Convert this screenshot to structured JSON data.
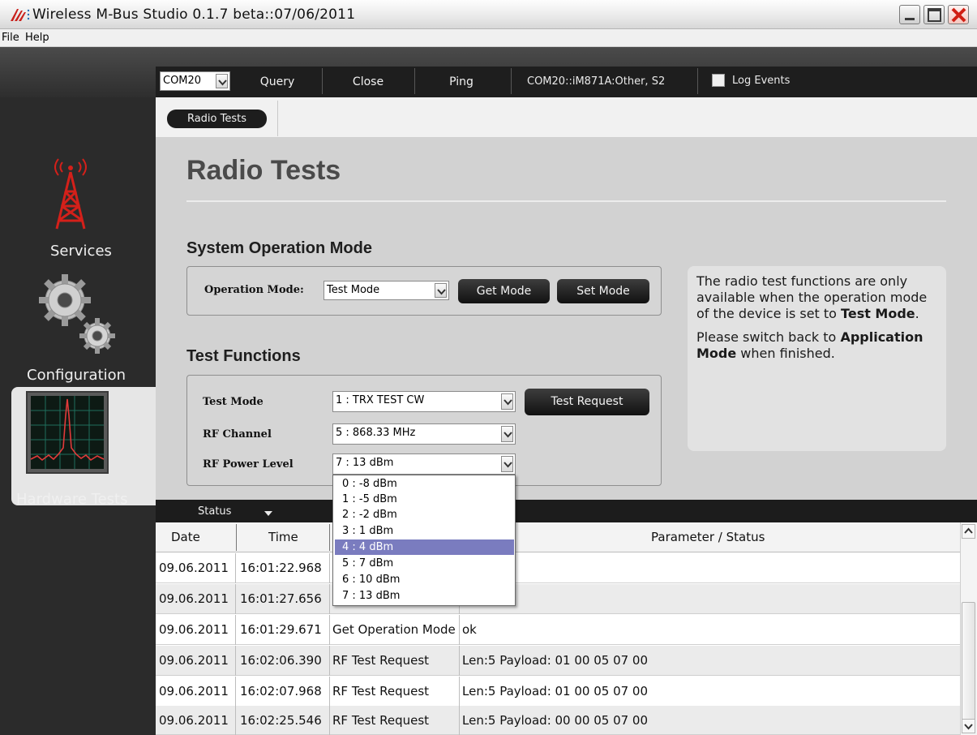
{
  "window": {
    "title": "Wireless M-Bus Studio  0.1.7 beta::07/06/2011"
  },
  "menu": {
    "items": [
      "File",
      "Help"
    ]
  },
  "toolbar": {
    "port_value": "COM20",
    "buttons": [
      "Query",
      "Close",
      "Ping"
    ],
    "connection_status": "COM20::iM871A:Other, S2",
    "log_events_label": "Log Events"
  },
  "sidebar": {
    "items": [
      {
        "label": "Services",
        "icon": "radio-tower-icon"
      },
      {
        "label": "Configuration",
        "icon": "gears-icon"
      },
      {
        "label": "Hardware Tests",
        "icon": "oscilloscope-icon"
      }
    ],
    "selected": "Hardware Tests"
  },
  "breadcrumb": {
    "current": "Radio Tests"
  },
  "page": {
    "title": "Radio Tests",
    "system_section": "System Operation Mode",
    "operation_mode_label": "Operation Mode:",
    "operation_mode_value": "Test Mode",
    "get_mode_label": "Get Mode",
    "set_mode_label": "Set Mode",
    "test_section": "Test Functions",
    "test_mode_label": "Test Mode",
    "test_mode_value": "1 : TRX TEST CW",
    "test_request_label": "Test Request",
    "rf_channel_label": "RF Channel",
    "rf_channel_value": "5 : 868.33 MHz",
    "rf_power_label": "RF Power Level",
    "rf_power_value": "7 : 13 dBm"
  },
  "info": {
    "p1_a": "The radio test functions are only available when the operation mode of the device is set to ",
    "p1_b": "Test Mode",
    "p1_c": ".",
    "p2_a": "Please switch back to ",
    "p2_b": "Application Mode",
    "p2_c": " when finished."
  },
  "dropdown": {
    "options": [
      "0 : -8 dBm",
      "1 : -5 dBm",
      "2 : -2 dBm",
      "3 :  1 dBm",
      "4 :  4 dBm",
      "5 :  7 dBm",
      "6 : 10 dBm",
      "7 : 13 dBm"
    ],
    "highlighted": "4 :  4 dBm"
  },
  "status": {
    "label": "Status",
    "columns": [
      "Date",
      "Time",
      "Parameter / Status"
    ],
    "rows": [
      {
        "date": "09.06.2011",
        "time": "16:01:22.968",
        "event": "",
        "param": ""
      },
      {
        "date": "09.06.2011",
        "time": "16:01:27.656",
        "event": "",
        "param": ""
      },
      {
        "date": "09.06.2011",
        "time": "16:01:29.671",
        "event": "Get Operation Mode",
        "param": "ok"
      },
      {
        "date": "09.06.2011",
        "time": "16:02:06.390",
        "event": "RF Test Request",
        "param": "Len:5 Payload: 01 00 05 07 00"
      },
      {
        "date": "09.06.2011",
        "time": "16:02:07.968",
        "event": "RF Test Request",
        "param": "Len:5 Payload: 01 00 05 07 00"
      },
      {
        "date": "09.06.2011",
        "time": "16:02:25.546",
        "event": "RF Test Request",
        "param": "Len:5 Payload: 00 00 05 07 00"
      }
    ]
  },
  "colors": {
    "toolbar_bg": "#2e2e2e",
    "main_bg": "#d2d2d2",
    "dropdown_highlight": "#7a7cbf",
    "dark_button": "#111111"
  }
}
